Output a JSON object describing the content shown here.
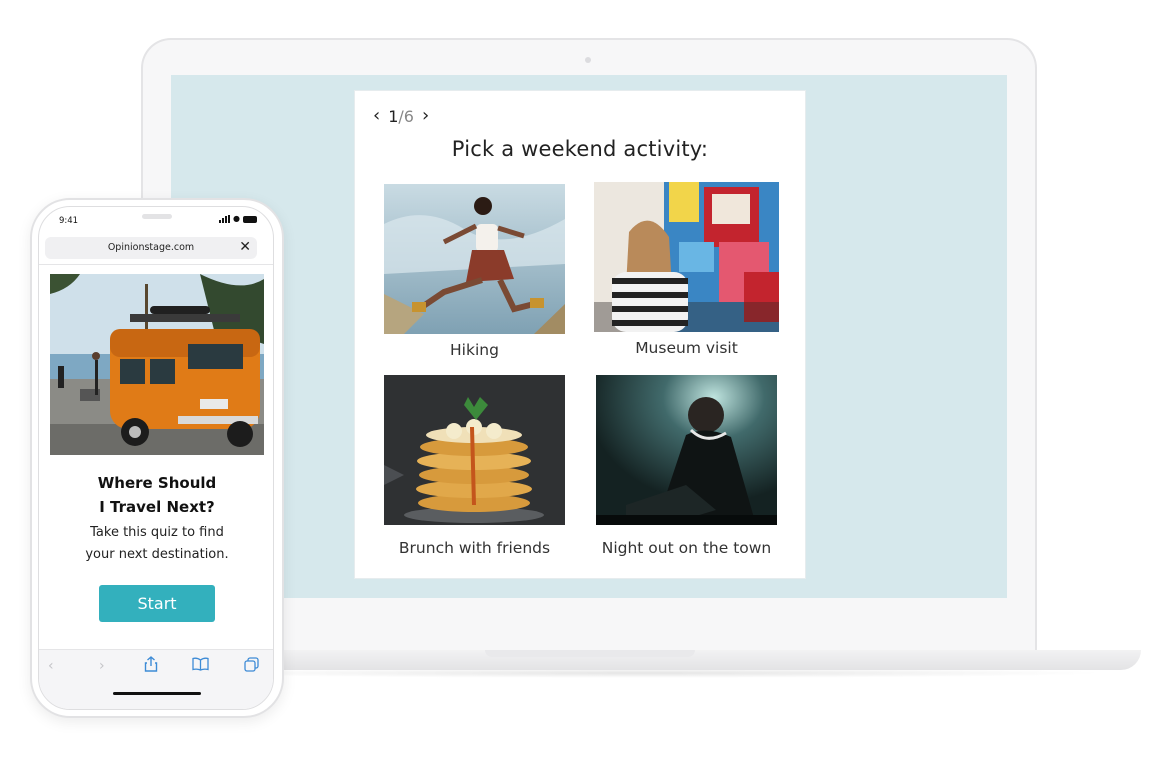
{
  "quiz": {
    "nav": {
      "current": "1",
      "separator": "/",
      "total": "6"
    },
    "question": "Pick a weekend activity:",
    "options": [
      {
        "label": "Hiking",
        "image": "woman-jumping-photo"
      },
      {
        "label": "Museum visit",
        "image": "museum-painting-photo"
      },
      {
        "label": "Brunch with friends",
        "image": "pancake-stack-photo"
      },
      {
        "label": "Night out on the town",
        "image": "dj-photo"
      }
    ]
  },
  "phone": {
    "status_time": "9:41",
    "url": "Opinionstage.com",
    "hero_image": "orange-van-beach-photo",
    "title_line1": "Where Should",
    "title_line2": "I Travel Next?",
    "desc_line1": "Take this quiz to find",
    "desc_line2": "your next destination.",
    "start_label": "Start",
    "toolbar": [
      "back-icon",
      "forward-icon",
      "share-icon",
      "bookmarks-icon",
      "tabs-icon"
    ]
  },
  "colors": {
    "screen_bg": "#d6e8ec",
    "accent": "#33b0bd"
  }
}
